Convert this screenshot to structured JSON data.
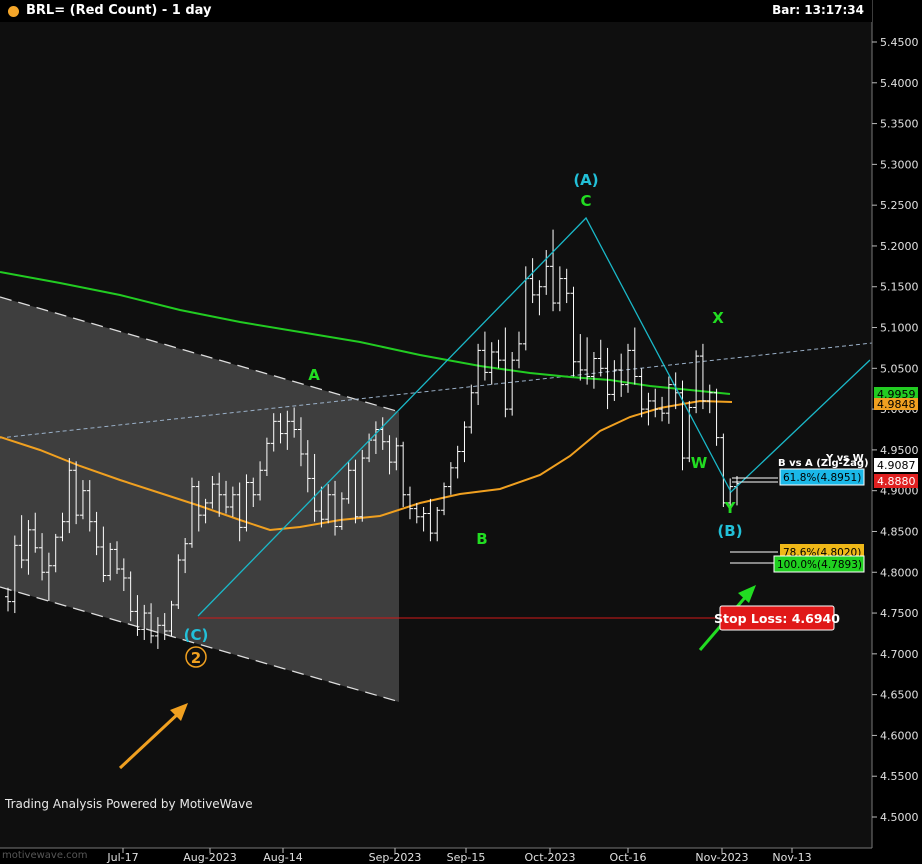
{
  "header": {
    "title": "BRL= (Red Count) - 1 day",
    "bar_time": "Bar: 13:17:34",
    "dot_color": "#f4a62a"
  },
  "footer": {
    "powered_by": "Trading Analysis Powered by MotiveWave",
    "watermark": "motivewave.com"
  },
  "colors": {
    "background": "#0f0f0f",
    "axis_bg": "#000000",
    "candles": "#ffffff",
    "ma_green": "#22cc22",
    "ma_orange": "#f0a020",
    "wave_lines": "#1ab8c8",
    "green_label": "#22dd22",
    "cyan_label": "#22c0d8",
    "orange_label": "#f0a020",
    "stop_loss": "#e82020",
    "channel_fill": "#4a4a4a"
  },
  "chart_data": {
    "type": "candlestick",
    "interval": "1 day",
    "y_axis": {
      "range": [
        4.45,
        5.49
      ],
      "ticks": [
        "5.4500",
        "5.4000",
        "5.3500",
        "5.3000",
        "5.2500",
        "5.2000",
        "5.1500",
        "5.1000",
        "5.0500",
        "5.0000",
        "4.9500",
        "4.9000",
        "4.8500",
        "4.8000",
        "4.7500",
        "4.7000",
        "4.6500",
        "4.6000",
        "4.5500",
        "4.5000"
      ]
    },
    "x_axis": {
      "ticks": [
        "Jul-17",
        "Aug-2023",
        "Aug-14",
        "Sep-2023",
        "Sep-15",
        "Oct-2023",
        "Oct-16",
        "Nov-2023",
        "Nov-13"
      ]
    },
    "ohlc": [
      [
        4.77,
        4.781,
        4.752,
        4.764
      ],
      [
        4.764,
        4.845,
        4.75,
        4.833
      ],
      [
        4.833,
        4.87,
        4.805,
        4.815
      ],
      [
        4.815,
        4.864,
        4.797,
        4.852
      ],
      [
        4.852,
        4.873,
        4.824,
        4.83
      ],
      [
        4.83,
        4.848,
        4.79,
        4.8
      ],
      [
        4.8,
        4.824,
        4.765,
        4.808
      ],
      [
        4.808,
        4.847,
        4.8,
        4.843
      ],
      [
        4.843,
        4.873,
        4.838,
        4.862
      ],
      [
        4.862,
        4.94,
        4.848,
        4.925
      ],
      [
        4.925,
        4.936,
        4.859,
        4.87
      ],
      [
        4.87,
        4.913,
        4.865,
        4.9
      ],
      [
        4.9,
        4.913,
        4.85,
        4.862
      ],
      [
        4.862,
        4.874,
        4.821,
        4.831
      ],
      [
        4.831,
        4.856,
        4.788,
        4.796
      ],
      [
        4.796,
        4.836,
        4.79,
        4.828
      ],
      [
        4.828,
        4.838,
        4.798,
        4.804
      ],
      [
        4.804,
        4.817,
        4.777,
        4.793
      ],
      [
        4.793,
        4.801,
        4.74,
        4.752
      ],
      [
        4.752,
        4.772,
        4.722,
        4.73
      ],
      [
        4.73,
        4.76,
        4.717,
        4.75
      ],
      [
        4.75,
        4.762,
        4.713,
        4.722
      ],
      [
        4.722,
        4.745,
        4.706,
        4.735
      ],
      [
        4.735,
        4.75,
        4.717,
        4.728
      ],
      [
        4.728,
        4.765,
        4.722,
        4.76
      ],
      [
        4.76,
        4.822,
        4.755,
        4.815
      ],
      [
        4.815,
        4.842,
        4.799,
        4.835
      ],
      [
        4.835,
        4.916,
        4.83,
        4.905
      ],
      [
        4.905,
        4.912,
        4.85,
        4.87
      ],
      [
        4.87,
        4.89,
        4.86,
        4.885
      ],
      [
        4.885,
        4.918,
        4.878,
        4.908
      ],
      [
        4.908,
        4.922,
        4.868,
        4.895
      ],
      [
        4.895,
        4.912,
        4.872,
        4.88
      ],
      [
        4.88,
        4.905,
        4.868,
        4.895
      ],
      [
        4.895,
        4.91,
        4.838,
        4.855
      ],
      [
        4.855,
        4.92,
        4.85,
        4.91
      ],
      [
        4.91,
        4.916,
        4.88,
        4.895
      ],
      [
        4.895,
        4.936,
        4.888,
        4.925
      ],
      [
        4.925,
        4.965,
        4.918,
        4.958
      ],
      [
        4.958,
        4.995,
        4.948,
        4.985
      ],
      [
        4.985,
        4.995,
        4.958,
        4.97
      ],
      [
        4.97,
        4.998,
        4.95,
        4.985
      ],
      [
        4.985,
        5.002,
        4.965,
        4.975
      ],
      [
        4.975,
        4.99,
        4.93,
        4.945
      ],
      [
        4.945,
        4.962,
        4.898,
        4.915
      ],
      [
        4.915,
        4.945,
        4.862,
        4.875
      ],
      [
        4.875,
        4.905,
        4.855,
        4.865
      ],
      [
        4.865,
        4.908,
        4.86,
        4.895
      ],
      [
        4.895,
        4.912,
        4.845,
        4.856
      ],
      [
        4.856,
        4.898,
        4.852,
        4.89
      ],
      [
        4.89,
        4.935,
        4.884,
        4.925
      ],
      [
        4.925,
        4.938,
        4.86,
        4.868
      ],
      [
        4.868,
        4.95,
        4.862,
        4.94
      ],
      [
        4.94,
        4.97,
        4.935,
        4.962
      ],
      [
        4.962,
        4.985,
        4.945,
        4.975
      ],
      [
        4.975,
        4.99,
        4.95,
        4.96
      ],
      [
        4.96,
        4.968,
        4.92,
        4.935
      ],
      [
        4.935,
        4.965,
        4.925,
        4.955
      ],
      [
        4.955,
        4.96,
        4.88,
        4.895
      ],
      [
        4.895,
        4.905,
        4.865,
        4.878
      ],
      [
        4.878,
        4.885,
        4.86,
        4.868
      ],
      [
        4.868,
        4.88,
        4.85,
        4.872
      ],
      [
        4.872,
        4.89,
        4.838,
        4.848
      ],
      [
        4.848,
        4.88,
        4.838,
        4.876
      ],
      [
        4.876,
        4.91,
        4.87,
        4.905
      ],
      [
        4.905,
        4.935,
        4.895,
        4.928
      ],
      [
        4.928,
        4.955,
        4.915,
        4.948
      ],
      [
        4.948,
        4.985,
        4.935,
        4.978
      ],
      [
        4.978,
        5.03,
        4.97,
        5.02
      ],
      [
        5.02,
        5.08,
        5.005,
        5.072
      ],
      [
        5.072,
        5.095,
        5.035,
        5.045
      ],
      [
        5.045,
        5.082,
        5.03,
        5.07
      ],
      [
        5.07,
        5.085,
        5.05,
        5.06
      ],
      [
        5.06,
        5.1,
        4.99,
        5.0
      ],
      [
        5.0,
        5.07,
        4.992,
        5.06
      ],
      [
        5.06,
        5.095,
        5.05,
        5.08
      ],
      [
        5.08,
        5.175,
        5.072,
        5.16
      ],
      [
        5.16,
        5.185,
        5.13,
        5.14
      ],
      [
        5.14,
        5.158,
        5.115,
        5.15
      ],
      [
        5.15,
        5.195,
        5.14,
        5.175
      ],
      [
        5.175,
        5.22,
        5.12,
        5.13
      ],
      [
        5.13,
        5.175,
        5.12,
        5.16
      ],
      [
        5.16,
        5.172,
        5.13,
        5.142
      ],
      [
        5.142,
        5.15,
        5.04,
        5.058
      ],
      [
        5.058,
        5.092,
        5.035,
        5.048
      ],
      [
        5.048,
        5.088,
        5.03,
        5.04
      ],
      [
        5.04,
        5.07,
        5.025,
        5.062
      ],
      [
        5.062,
        5.085,
        5.04,
        5.05
      ],
      [
        5.05,
        5.075,
        5.0,
        5.018
      ],
      [
        5.018,
        5.06,
        5.01,
        5.048
      ],
      [
        5.048,
        5.068,
        5.015,
        5.03
      ],
      [
        5.03,
        5.08,
        5.02,
        5.072
      ],
      [
        5.072,
        5.1,
        5.03,
        5.04
      ],
      [
        5.04,
        5.05,
        4.99,
        5.0
      ],
      [
        5.0,
        5.02,
        4.98,
        5.01
      ],
      [
        5.01,
        5.025,
        4.99,
        5.0
      ],
      [
        5.0,
        5.015,
        4.985,
        4.995
      ],
      [
        4.995,
        5.04,
        4.982,
        5.03
      ],
      [
        5.03,
        5.045,
        5.0,
        5.02
      ],
      [
        5.02,
        5.035,
        4.925,
        4.94
      ],
      [
        4.94,
        5.01,
        4.935,
        5.002
      ],
      [
        5.002,
        5.072,
        4.995,
        5.065
      ],
      [
        5.065,
        5.08,
        5.0,
        5.01
      ],
      [
        5.01,
        5.03,
        4.995,
        5.02
      ],
      [
        5.02,
        5.025,
        4.955,
        4.965
      ],
      [
        4.965,
        4.97,
        4.88,
        4.885
      ],
      [
        4.885,
        4.915,
        4.878,
        4.905
      ],
      [
        4.905,
        4.918,
        4.882,
        4.9087
      ]
    ],
    "moving_averages": [
      {
        "color": "#22cc22",
        "last": "4.9959"
      },
      {
        "color": "#f0a020",
        "last": "4.9848"
      }
    ],
    "wave_labels": [
      {
        "text": "A",
        "color": "green"
      },
      {
        "text": "B",
        "color": "green"
      },
      {
        "text": "C",
        "color": "green"
      },
      {
        "text": "(A)",
        "color": "cyan"
      },
      {
        "text": "W",
        "color": "green"
      },
      {
        "text": "X",
        "color": "green"
      },
      {
        "text": "Y",
        "color": "green"
      },
      {
        "text": "(B)",
        "color": "cyan"
      },
      {
        "text": "(C)",
        "color": "cyan"
      },
      {
        "text": "2",
        "color": "orange"
      }
    ],
    "levels": [
      {
        "label": "61.8%(4.8951)",
        "value": 4.8951,
        "bg": "#1ab8e8",
        "fg": "#000"
      },
      {
        "label": "78.6%(4.8020)",
        "value": 4.802,
        "bg": "#f0b818",
        "fg": "#000"
      },
      {
        "label": "100.0%(4.7893)",
        "value": 4.7893,
        "bg": "#20d020",
        "fg": "#000"
      }
    ],
    "ratio_labels": [
      "B vs A (Zig-Zag)",
      "Y vs W"
    ],
    "stop_loss": {
      "label": "Stop Loss: 4.6940",
      "value": 4.694
    },
    "axis_price_boxes": [
      {
        "text": "4.9959",
        "bg": "#22cc22",
        "fg": "#000"
      },
      {
        "text": "4.9848",
        "bg": "#f0a020",
        "fg": "#000"
      },
      {
        "text": "4.9087",
        "bg": "#ffffff",
        "fg": "#000"
      },
      {
        "text": "4.8880",
        "bg": "#e02020",
        "fg": "#fff"
      }
    ]
  }
}
